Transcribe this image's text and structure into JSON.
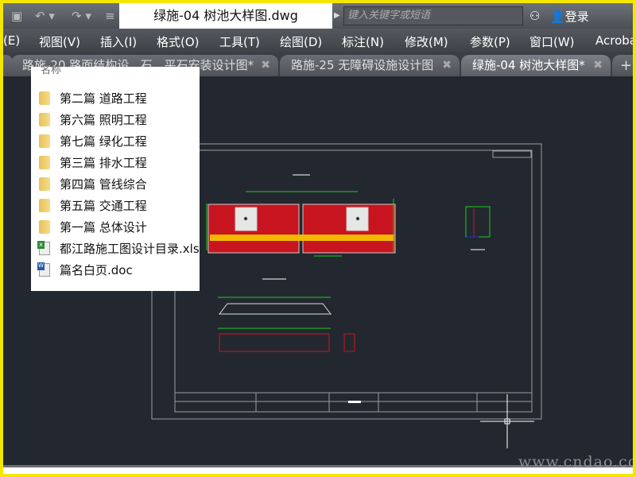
{
  "titlebar": {
    "document_title": "绿施-04 树池大样图.dwg",
    "search_placeholder": "键入关键字或短语",
    "login_label": "登录"
  },
  "menu": [
    "(E)",
    "视图(V)",
    "插入(I)",
    "格式(O)",
    "工具(T)",
    "绘图(D)",
    "标注(N)",
    "修改(M)",
    "参数(P)",
    "窗口(W)",
    "Acroba"
  ],
  "tabs": [
    {
      "label": "路施-20 路面结构设...石、平石安装设计图*",
      "close": "✖"
    },
    {
      "label": "路施-25 无障碍设施设计图",
      "close": "✖"
    },
    {
      "label": "绿施-04 树池大样图*",
      "close": "✖",
      "active": true
    }
  ],
  "new_tab": "+",
  "panel": {
    "header": "名称",
    "items": [
      {
        "label": "第二篇 道路工程",
        "type": "folder"
      },
      {
        "label": "第六篇 照明工程",
        "type": "folder"
      },
      {
        "label": "第七篇 绿化工程",
        "type": "folder"
      },
      {
        "label": "第三篇 排水工程",
        "type": "folder"
      },
      {
        "label": "第四篇 管线综合",
        "type": "folder"
      },
      {
        "label": "第五篇 交通工程",
        "type": "folder"
      },
      {
        "label": "第一篇 总体设计",
        "type": "folder"
      },
      {
        "label": "都江路施工图设计目录.xls",
        "type": "xls"
      },
      {
        "label": "篇名白页.doc",
        "type": "doc"
      }
    ]
  },
  "watermark": "www.cndao.com"
}
